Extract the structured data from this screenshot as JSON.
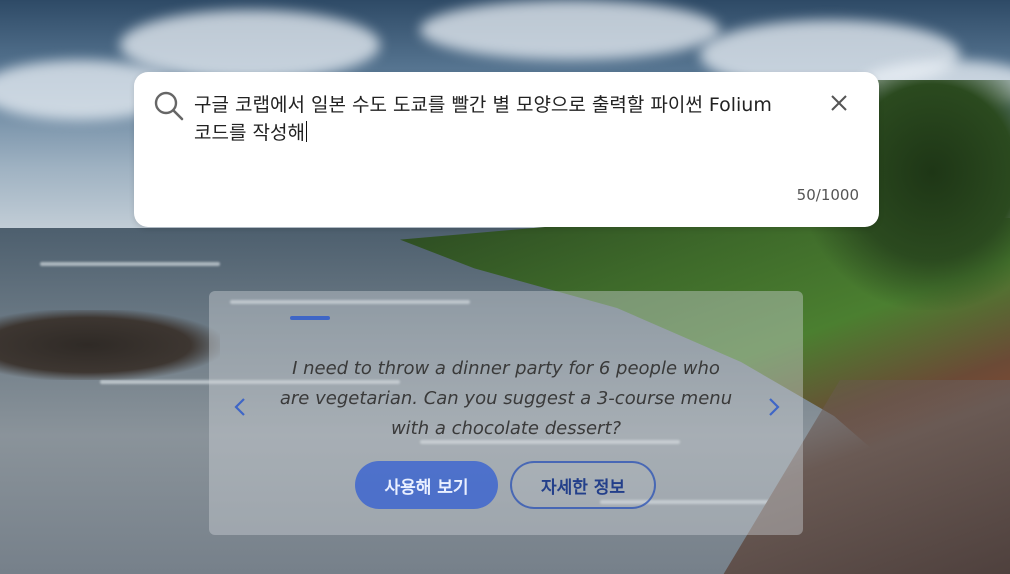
{
  "search": {
    "query": "구글 코랩에서 일본 수도 도쿄를 빨간 별 모양으로 출력할 파이썬 Folium 코드를 작성해",
    "counter": "50/1000",
    "search_icon": "search-icon",
    "close_icon": "close-icon"
  },
  "suggestion": {
    "prompt": "I need to throw a dinner party for 6 people who are vegetarian. Can you suggest a 3-course menu with a chocolate dessert?",
    "try_button": "사용해 보기",
    "more_button": "자세한 정보",
    "prev_icon": "chevron-left-icon",
    "next_icon": "chevron-right-icon"
  },
  "colors": {
    "accent": "#2c5ad4",
    "card_bg": "#ffffff"
  }
}
